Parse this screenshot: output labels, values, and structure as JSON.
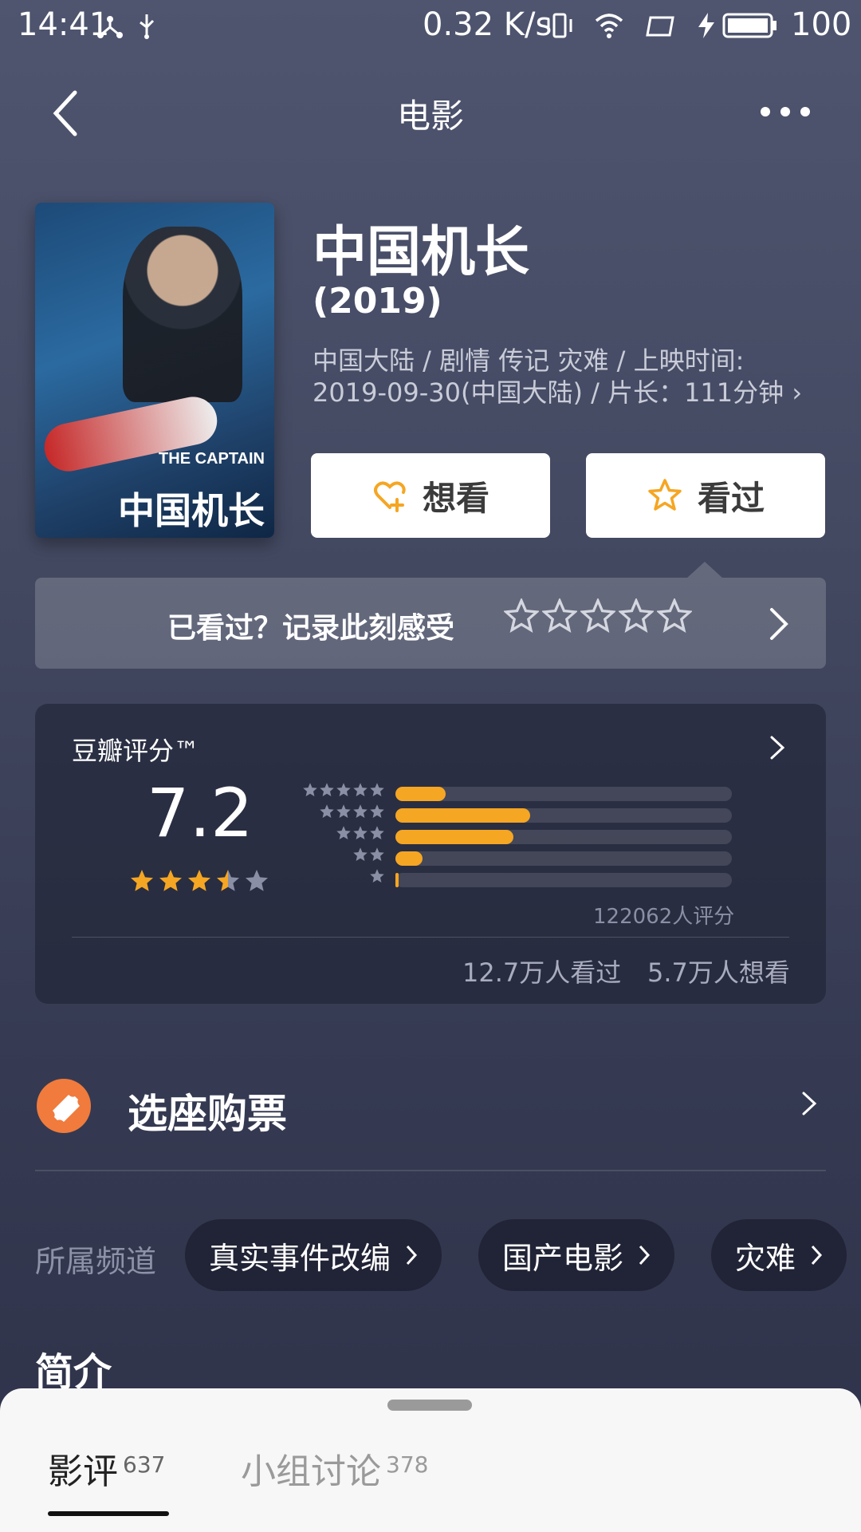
{
  "status_bar": {
    "time": "14:41",
    "network_speed": "0.32 K/s",
    "battery": "100"
  },
  "nav": {
    "title": "电影"
  },
  "movie": {
    "title": "中国机长",
    "year": "(2019)",
    "meta_line1": "中国大陆 / 剧情 传记 灾难 / 上映时间:",
    "meta_line2": "2019-09-30(中国大陆) / 片长：111分钟 ›",
    "poster_title_en": "THE CAPTAIN",
    "poster_title_cn": "中国机长"
  },
  "actions": {
    "want_label": "想看",
    "seen_label": "看过"
  },
  "record": {
    "text": "已看过？记录此刻感受",
    "stars": 5
  },
  "rating": {
    "label": "豆瓣评分™",
    "score": "7.2",
    "score_stars": 3.5,
    "distribution": [
      {
        "stars": 5,
        "fraction": 0.15
      },
      {
        "stars": 4,
        "fraction": 0.4
      },
      {
        "stars": 3,
        "fraction": 0.35
      },
      {
        "stars": 2,
        "fraction": 0.08
      },
      {
        "stars": 1,
        "fraction": 0.01
      }
    ],
    "count_text": "122062人评分",
    "seen_text": "12.7万人看过",
    "want_text": "5.7万人想看"
  },
  "ticket": {
    "label": "选座购票"
  },
  "channels": {
    "label": "所属频道",
    "items": [
      "真实事件改编",
      "国产电影",
      "灾难"
    ]
  },
  "intro": {
    "title": "简介"
  },
  "bottom_tabs": [
    {
      "label": "影评",
      "count": "637"
    },
    {
      "label": "小组讨论",
      "count": "378"
    }
  ],
  "colors": {
    "accent": "#f5a623",
    "ticket": "#f07b3c"
  }
}
